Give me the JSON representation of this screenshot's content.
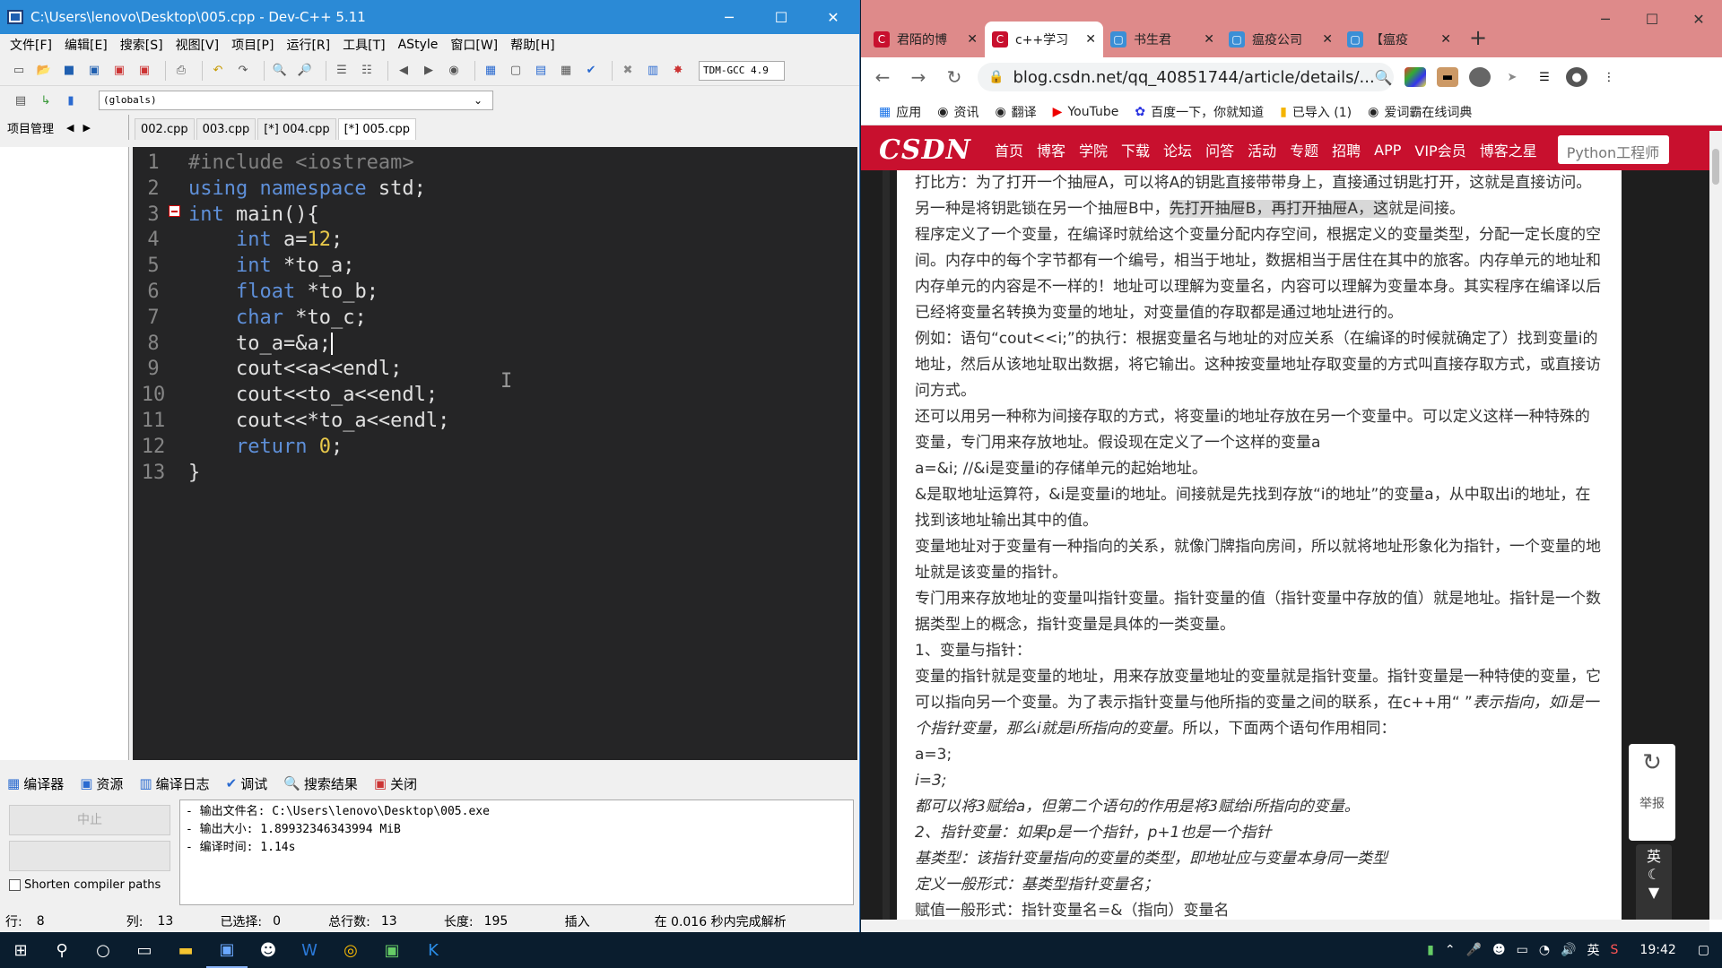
{
  "devcpp": {
    "title": "C:\\Users\\lenovo\\Desktop\\005.cpp - Dev-C++ 5.11",
    "menu": [
      "文件[F]",
      "编辑[E]",
      "搜索[S]",
      "视图[V]",
      "项目[P]",
      "运行[R]",
      "工具[T]",
      "AStyle",
      "窗口[W]",
      "帮助[H]"
    ],
    "compiler_combo": "TDM-GCC 4.9",
    "globals_combo": "(globals)",
    "project_tab": "项目管理",
    "file_tabs": [
      "002.cpp",
      "003.cpp",
      "[*] 004.cpp",
      "[*] 005.cpp"
    ],
    "line_numbers": [
      "1",
      "2",
      "3",
      "4",
      "5",
      "6",
      "7",
      "8",
      "9",
      "10",
      "11",
      "12",
      "13"
    ],
    "code": {
      "l1": "#include <iostream>",
      "l2a": "using namespace",
      "l2b": " std;",
      "l3a": "int",
      "l3b": " main(){",
      "l4a": "int",
      "l4b": " a=",
      "l4c": "12",
      "l4d": ";",
      "l5a": "int",
      "l5b": " *to_a;",
      "l6a": "float",
      "l6b": " *to_b;",
      "l7a": "char",
      "l7b": " *to_c;",
      "l8": "to_a=&a;",
      "l9": "cout<<a<<endl;",
      "l10": "cout<<to_a<<endl;",
      "l11": "cout<<*to_a<<endl;",
      "l12a": "return",
      "l12b": "0",
      "l12c": ";",
      "l13": "}"
    },
    "bottom_tabs": [
      "编译器",
      "资源",
      "编译日志",
      "调试",
      "搜索结果",
      "关闭"
    ],
    "abort_button": "中止",
    "shorten_label": "Shorten compiler paths",
    "log": [
      "- 输出文件名: C:\\Users\\lenovo\\Desktop\\005.exe",
      "- 输出大小: 1.89932346343994 MiB",
      "- 编译时间: 1.14s"
    ],
    "status": {
      "row_label": "行:",
      "row": "8",
      "col_label": "列:",
      "col": "13",
      "sel_label": "已选择:",
      "sel": "0",
      "lines_label": "总行数:",
      "lines": "13",
      "len_label": "长度:",
      "len": "195",
      "mode": "插入",
      "parse": "在 0.016 秒内完成解析"
    }
  },
  "chrome": {
    "tabs": [
      "君陌的博",
      "c++学习",
      "书生君",
      "瘟疫公司",
      "【瘟疫"
    ],
    "url": "blog.csdn.net/qq_40851744/article/details/...",
    "bookmarks": [
      "应用",
      "资讯",
      "翻译",
      "YouTube",
      "百度一下，你就知道",
      "已导入 (1)",
      "爱词霸在线词典"
    ],
    "csdn_logo": "CSDN",
    "csdn_nav": [
      "首页",
      "博客",
      "学院",
      "下载",
      "论坛",
      "问答",
      "活动",
      "专题",
      "招聘",
      "APP",
      "VIP会员",
      "博客之星"
    ],
    "search_placeholder": "Python工程师",
    "article": {
      "p1": "打比方：为了打开一个抽屉A，可以将A的钥匙直接带带身上，直接通过钥匙打开，这就是直接访问。",
      "p2a": "另一种是将钥匙锁在另一个抽屉B中，",
      "p2b": "先打开抽屉B，再打开抽屉A，这",
      "p2c": "就是间接。",
      "p3": "程序定义了一个变量，在编译时就给这个变量分配内存空间，根据定义的变量类型，分配一定长度的空间。内存中的每个字节都有一个编号，相当于地址，数据相当于居住在其中的旅客。内存单元的地址和内存单元的内容是不一样的！地址可以理解为变量名，内容可以理解为变量本身。其实程序在编译以后已经将变量名转换为变量的地址，对变量值的存取都是通过地址进行的。",
      "p4": "例如：语句“cout<<i;”的执行：根据变量名与地址的对应关系（在编译的时候就确定了）找到变量i的地址，然后从该地址取出数据，将它输出。这种按变量地址存取变量的方式叫直接存取方式，或直接访问方式。",
      "p5": "还可以用另一种称为间接存取的方式，将变量i的地址存放在另一个变量中。可以定义这样一种特殊的变量，专门用来存放地址。假设现在定义了一个这样的变量a",
      "p6": "a=&i;  //&i是变量i的存储单元的起始地址。",
      "p7": "&是取地址运算符，&i是变量i的地址。间接就是先找到存放“i的地址”的变量a，从中取出i的地址，在找到该地址输出其中的值。",
      "p8": "变量地址对于变量有一种指向的关系，就像门牌指向房间，所以就将地址形象化为指针，一个变量的地址就是该变量的指针。",
      "p9": "专门用来存放地址的变量叫指针变量。指针变量的值（指针变量中存放的值）就是地址。指针是一个数据类型上的概念，指针变量是具体的一类变量。",
      "p10": "1、变量与指针：",
      "p11a": "变量的指针就是变量的地址，用来存放变量地址的变量就是指针变量。指针变量是一种特使的变量，它可以指向另一个变量。为了表示指针变量与他所指的变量之间的联系，在c++用“ ”",
      "p11b": "表示指向，如i是一个指针变量，那么i就是i所指向的变量。",
      "p11c": "所以，下面两个语句作用相同：",
      "p12": "a=3;",
      "p13": "i=3;",
      "p14": "都可以将3赋给a，但第二个语句的作用是将3赋给i所指向的变量。",
      "p15": "2、指针变量：如果p是一个指针，p+1也是一个指针",
      "p16": "基类型：该指针变量指向的变量的类型，即地址应与变量本身同一类型",
      "p17": "定义一般形式：基类型指针变量名；",
      "p18": "赋值一般形式：指针变量名=&（指向）变量名"
    },
    "side_report": "举报",
    "ime_label": "英"
  },
  "taskbar": {
    "time": "19:42",
    "ime": "英"
  }
}
